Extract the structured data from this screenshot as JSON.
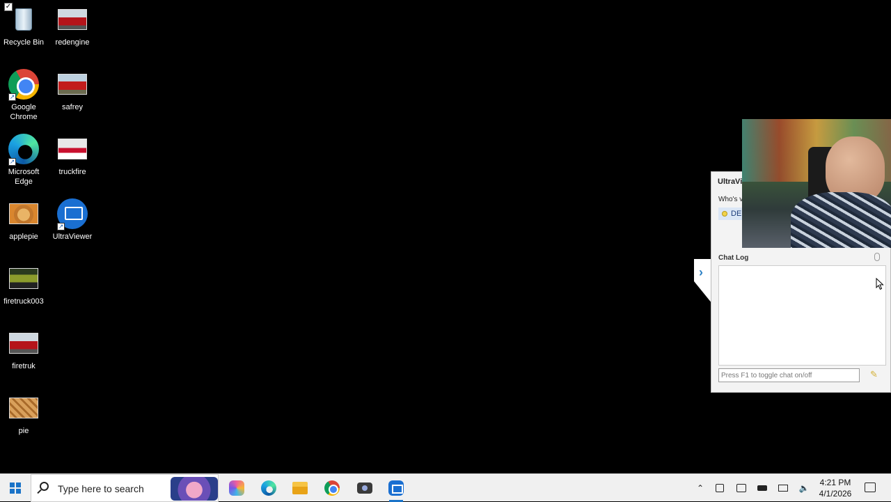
{
  "desktop": {
    "icons": [
      {
        "label": "Recycle Bin"
      },
      {
        "label": "redengine"
      },
      {
        "label": "Google\nChrome"
      },
      {
        "label": "safrey"
      },
      {
        "label": "Microsoft\nEdge"
      },
      {
        "label": "truckfire"
      },
      {
        "label": "applepie"
      },
      {
        "label": "UltraViewer"
      },
      {
        "label": "firetruck003"
      },
      {
        "label": "firetruk"
      },
      {
        "label": "pie"
      }
    ]
  },
  "ultraviewer": {
    "title": "UltraVi",
    "who_label": "Who's v",
    "user_name": "DE",
    "chat_log_label": "Chat Log",
    "chat_input_placeholder": "Press F1 to toggle chat on/off",
    "collapse_glyph": "›"
  },
  "taskbar": {
    "search_placeholder": "Type here to search",
    "time": "4:21 PM",
    "date": "4/1/2026",
    "tray_glyphs": {
      "chevron": "⌃",
      "volume": "🔈"
    }
  },
  "colors": {
    "taskbar_bg": "#f0f0f0",
    "accent": "#1a73c8",
    "desktop_bg": "#000000"
  }
}
